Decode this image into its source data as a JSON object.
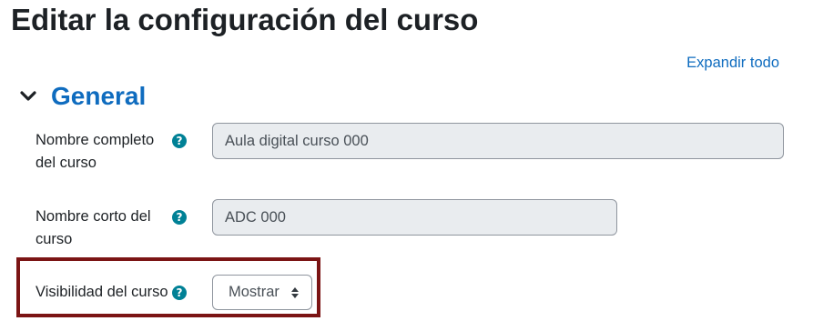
{
  "page": {
    "title": "Editar la configuración del curso",
    "expand_all": "Expandir todo"
  },
  "section": {
    "title": "General",
    "collapse_icon": "chevron-down-icon"
  },
  "fields": {
    "fullname": {
      "label": "Nombre completo del curso",
      "value": "Aula digital curso 000",
      "help_icon": "question-circle-icon"
    },
    "shortname": {
      "label": "Nombre corto del curso",
      "value": "ADC 000",
      "help_icon": "question-circle-icon"
    },
    "visibility": {
      "label": "Visibilidad del curso",
      "selected": "Mostrar",
      "help_icon": "question-circle-icon"
    }
  },
  "colors": {
    "link": "#0f6cbf",
    "help_icon": "#008196",
    "highlight_border": "#7b1414",
    "input_readonly_bg": "#e9ecef"
  }
}
